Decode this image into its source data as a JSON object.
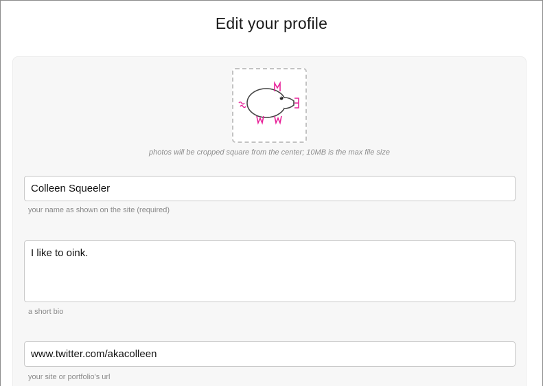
{
  "page": {
    "title": "Edit your profile"
  },
  "photo": {
    "icon": "pig-avatar-icon",
    "hint": "photos will be cropped square from the center; 10MB is the max file size"
  },
  "fields": {
    "name": {
      "value": "Colleen Squeeler",
      "hint": "your name as shown on the site (required)"
    },
    "bio": {
      "value": "I like to oink.",
      "hint": "a short bio"
    },
    "url": {
      "value": "www.twitter.com/akacolleen",
      "hint": "your site or portfolio's url"
    }
  },
  "colors": {
    "accent": "#e8249a",
    "outline": "#444444",
    "dashed_border": "#c2c2c2",
    "card_background": "#f7f7f7"
  }
}
